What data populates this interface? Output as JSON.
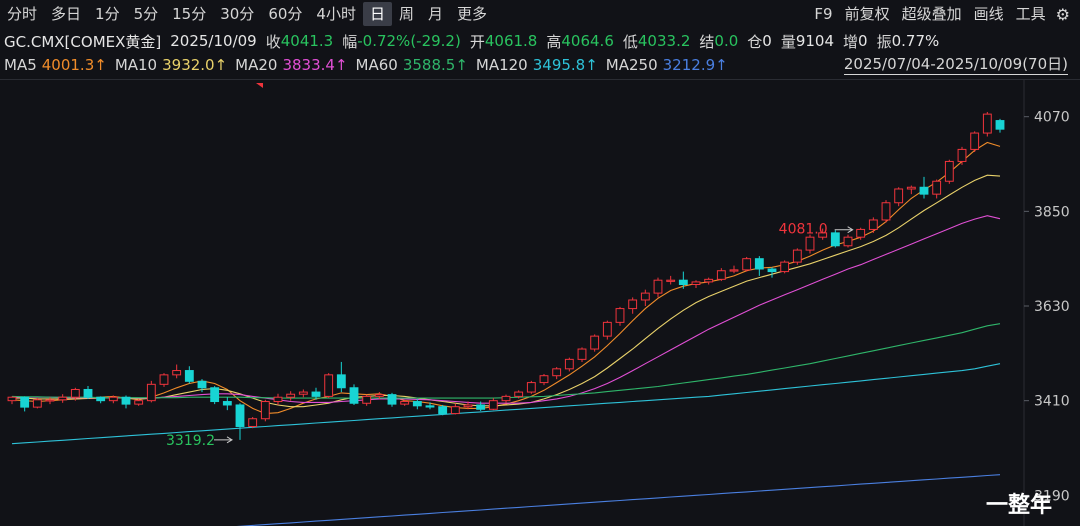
{
  "toolbar": {
    "periods": [
      "分时",
      "多日",
      "1分",
      "5分",
      "15分",
      "30分",
      "60分",
      "4小时",
      "日",
      "周",
      "月",
      "更多"
    ],
    "active_period": "日",
    "tools": [
      "F9",
      "前复权",
      "超级叠加",
      "画线",
      "工具"
    ],
    "gear_icon": "gear-icon"
  },
  "info": {
    "symbol": "GC.CMX[COMEX黄金]",
    "date": "2025/10/09",
    "close_label": "收",
    "close": "4041.3",
    "change_label": "幅",
    "change": "-0.72%(-29.2)",
    "open_label": "开",
    "open": "4061.8",
    "high_label": "高",
    "high": "4064.6",
    "low_label": "低",
    "low": "4033.2",
    "settle_label": "结",
    "settle": "0.0",
    "oi_label": "仓",
    "oi": "0",
    "volume_label": "量",
    "volume": "9104",
    "oi_change_label": "增",
    "oi_change": "0",
    "amplitude_label": "振",
    "amplitude": "0.77%"
  },
  "ma_row": [
    {
      "label": "MA5",
      "value": "4001.3↑",
      "color": "#f08c2a"
    },
    {
      "label": "MA10",
      "value": "3932.0↑",
      "color": "#e8d16a"
    },
    {
      "label": "MA20",
      "value": "3833.4↑",
      "color": "#e04fd4"
    },
    {
      "label": "MA60",
      "value": "3588.5↑",
      "color": "#2fb56a"
    },
    {
      "label": "MA120",
      "value": "3495.8↑",
      "color": "#2ec2d8"
    },
    {
      "label": "MA250",
      "value": "3212.9↑",
      "color": "#4a7fe0"
    }
  ],
  "date_range": "2025/07/04-2025/10/09(70日)",
  "watermark": "一整年",
  "chart_data": {
    "type": "candlestick",
    "y_ticks": [
      3190,
      3410,
      3630,
      3850,
      4070
    ],
    "ylim": [
      3128,
      4146
    ],
    "grid": false,
    "up_color": "#f0343c",
    "down_color": "#18d4d4",
    "annotations": [
      {
        "text": "4081.0",
        "color": "#f0343c",
        "at_index": 67
      },
      {
        "text": "3319.2",
        "color": "#29c35f",
        "at_index": 18
      }
    ],
    "candles": [
      [
        3410,
        3418,
        3402,
        3420
      ],
      [
        3418,
        3395,
        3385,
        3420
      ],
      [
        3395,
        3412,
        3392,
        3416
      ],
      [
        3412,
        3412,
        3402,
        3418
      ],
      [
        3412,
        3418,
        3405,
        3425
      ],
      [
        3418,
        3436,
        3410,
        3440
      ],
      [
        3436,
        3418,
        3414,
        3444
      ],
      [
        3418,
        3410,
        3404,
        3420
      ],
      [
        3410,
        3418,
        3404,
        3422
      ],
      [
        3418,
        3402,
        3392,
        3422
      ],
      [
        3402,
        3410,
        3398,
        3414
      ],
      [
        3410,
        3448,
        3406,
        3456
      ],
      [
        3448,
        3470,
        3442,
        3474
      ],
      [
        3470,
        3480,
        3462,
        3494
      ],
      [
        3480,
        3455,
        3450,
        3490
      ],
      [
        3455,
        3440,
        3430,
        3460
      ],
      [
        3440,
        3408,
        3402,
        3444
      ],
      [
        3408,
        3400,
        3388,
        3418
      ],
      [
        3400,
        3350,
        3319,
        3404
      ],
      [
        3350,
        3368,
        3346,
        3372
      ],
      [
        3368,
        3408,
        3362,
        3412
      ],
      [
        3408,
        3418,
        3400,
        3426
      ],
      [
        3418,
        3425,
        3410,
        3432
      ],
      [
        3425,
        3430,
        3418,
        3436
      ],
      [
        3430,
        3420,
        3412,
        3440
      ],
      [
        3420,
        3470,
        3416,
        3474
      ],
      [
        3470,
        3440,
        3430,
        3500
      ],
      [
        3440,
        3404,
        3400,
        3448
      ],
      [
        3404,
        3420,
        3398,
        3424
      ],
      [
        3420,
        3424,
        3414,
        3430
      ],
      [
        3424,
        3402,
        3396,
        3428
      ],
      [
        3402,
        3408,
        3398,
        3412
      ],
      [
        3408,
        3398,
        3390,
        3414
      ],
      [
        3398,
        3396,
        3390,
        3406
      ],
      [
        3396,
        3380,
        3376,
        3400
      ],
      [
        3380,
        3396,
        3378,
        3404
      ],
      [
        3396,
        3400,
        3390,
        3408
      ],
      [
        3400,
        3390,
        3386,
        3408
      ],
      [
        3390,
        3410,
        3388,
        3416
      ],
      [
        3410,
        3420,
        3405,
        3424
      ],
      [
        3420,
        3430,
        3415,
        3434
      ],
      [
        3430,
        3452,
        3426,
        3456
      ],
      [
        3452,
        3468,
        3446,
        3472
      ],
      [
        3468,
        3484,
        3460,
        3488
      ],
      [
        3484,
        3506,
        3478,
        3510
      ],
      [
        3506,
        3530,
        3500,
        3534
      ],
      [
        3530,
        3560,
        3524,
        3564
      ],
      [
        3560,
        3592,
        3552,
        3596
      ],
      [
        3592,
        3624,
        3584,
        3628
      ],
      [
        3624,
        3644,
        3612,
        3650
      ],
      [
        3644,
        3660,
        3630,
        3668
      ],
      [
        3660,
        3690,
        3650,
        3696
      ],
      [
        3690,
        3690,
        3680,
        3700
      ],
      [
        3690,
        3680,
        3670,
        3710
      ],
      [
        3680,
        3686,
        3672,
        3690
      ],
      [
        3686,
        3692,
        3680,
        3696
      ],
      [
        3692,
        3712,
        3688,
        3718
      ],
      [
        3712,
        3714,
        3706,
        3724
      ],
      [
        3714,
        3740,
        3710,
        3744
      ],
      [
        3740,
        3716,
        3700,
        3746
      ],
      [
        3716,
        3710,
        3696,
        3720
      ],
      [
        3710,
        3732,
        3706,
        3736
      ],
      [
        3732,
        3760,
        3726,
        3764
      ],
      [
        3760,
        3790,
        3752,
        3796
      ],
      [
        3790,
        3800,
        3784,
        3810
      ],
      [
        3800,
        3770,
        3766,
        3806
      ],
      [
        3770,
        3790,
        3766,
        3796
      ],
      [
        3790,
        3808,
        3784,
        3812
      ],
      [
        3808,
        3830,
        3800,
        3836
      ],
      [
        3830,
        3870,
        3824,
        3876
      ],
      [
        3870,
        3902,
        3862,
        3906
      ],
      [
        3902,
        3906,
        3890,
        3910
      ],
      [
        3906,
        3890,
        3880,
        3930
      ],
      [
        3890,
        3920,
        3880,
        3924
      ],
      [
        3920,
        3966,
        3914,
        3970
      ],
      [
        3966,
        3994,
        3958,
        4000
      ],
      [
        3994,
        4032,
        3988,
        4036
      ],
      [
        4032,
        4076,
        4024,
        4081
      ],
      [
        4061,
        4041,
        4033,
        4065
      ]
    ],
    "ma_lines": {
      "MA5": [
        3412,
        3410,
        3408,
        3410,
        3412,
        3414,
        3416,
        3418,
        3420,
        3416,
        3412,
        3418,
        3428,
        3440,
        3450,
        3456,
        3450,
        3436,
        3410,
        3392,
        3380,
        3382,
        3392,
        3404,
        3414,
        3420,
        3428,
        3426,
        3424,
        3426,
        3420,
        3410,
        3408,
        3404,
        3398,
        3394,
        3392,
        3392,
        3396,
        3402,
        3410,
        3420,
        3434,
        3452,
        3470,
        3490,
        3512,
        3538,
        3566,
        3596,
        3624,
        3648,
        3666,
        3676,
        3682,
        3686,
        3692,
        3700,
        3712,
        3718,
        3720,
        3726,
        3734,
        3746,
        3760,
        3772,
        3780,
        3790,
        3804,
        3826,
        3854,
        3880,
        3900,
        3918,
        3940,
        3966,
        3992,
        4010,
        4001
      ],
      "MA10": [
        3416,
        3416,
        3414,
        3414,
        3414,
        3414,
        3415,
        3416,
        3417,
        3416,
        3414,
        3415,
        3418,
        3424,
        3430,
        3436,
        3438,
        3434,
        3426,
        3416,
        3406,
        3400,
        3396,
        3396,
        3400,
        3404,
        3412,
        3418,
        3420,
        3422,
        3422,
        3420,
        3416,
        3412,
        3408,
        3404,
        3400,
        3398,
        3398,
        3400,
        3402,
        3406,
        3414,
        3424,
        3436,
        3450,
        3466,
        3486,
        3508,
        3530,
        3554,
        3578,
        3600,
        3620,
        3638,
        3652,
        3664,
        3676,
        3688,
        3696,
        3704,
        3712,
        3720,
        3728,
        3738,
        3748,
        3758,
        3768,
        3780,
        3794,
        3812,
        3832,
        3852,
        3870,
        3888,
        3906,
        3922,
        3934,
        3932
      ],
      "MA20": [
        3418,
        3418,
        3418,
        3418,
        3417,
        3417,
        3417,
        3417,
        3417,
        3417,
        3416,
        3416,
        3418,
        3420,
        3422,
        3424,
        3426,
        3426,
        3424,
        3420,
        3416,
        3412,
        3408,
        3406,
        3406,
        3406,
        3408,
        3410,
        3412,
        3414,
        3414,
        3414,
        3413,
        3412,
        3410,
        3408,
        3406,
        3404,
        3404,
        3404,
        3404,
        3406,
        3410,
        3414,
        3420,
        3428,
        3438,
        3450,
        3464,
        3480,
        3496,
        3512,
        3528,
        3544,
        3560,
        3576,
        3590,
        3604,
        3618,
        3632,
        3644,
        3656,
        3668,
        3680,
        3692,
        3704,
        3716,
        3726,
        3738,
        3750,
        3762,
        3774,
        3786,
        3798,
        3810,
        3822,
        3832,
        3840,
        3833
      ],
      "MA60": [
        3420,
        3419,
        3419,
        3418,
        3418,
        3418,
        3418,
        3417,
        3417,
        3417,
        3417,
        3417,
        3417,
        3417,
        3418,
        3418,
        3418,
        3418,
        3418,
        3417,
        3417,
        3416,
        3416,
        3416,
        3416,
        3416,
        3416,
        3416,
        3416,
        3416,
        3416,
        3416,
        3416,
        3416,
        3416,
        3416,
        3416,
        3416,
        3416,
        3417,
        3418,
        3419,
        3420,
        3422,
        3424,
        3426,
        3428,
        3431,
        3434,
        3437,
        3440,
        3443,
        3447,
        3451,
        3455,
        3459,
        3463,
        3467,
        3471,
        3476,
        3481,
        3486,
        3491,
        3496,
        3502,
        3508,
        3514,
        3520,
        3526,
        3532,
        3538,
        3544,
        3550,
        3556,
        3562,
        3568,
        3576,
        3584,
        3589
      ],
      "MA120": [
        3310,
        3312,
        3314,
        3316,
        3318,
        3320,
        3322,
        3324,
        3326,
        3328,
        3330,
        3332,
        3334,
        3336,
        3338,
        3340,
        3342,
        3344,
        3346,
        3348,
        3350,
        3352,
        3354,
        3356,
        3358,
        3360,
        3362,
        3364,
        3366,
        3368,
        3370,
        3372,
        3374,
        3376,
        3378,
        3380,
        3382,
        3384,
        3386,
        3388,
        3390,
        3392,
        3394,
        3396,
        3398,
        3400,
        3402,
        3404,
        3406,
        3408,
        3410,
        3412,
        3414,
        3416,
        3418,
        3420,
        3423,
        3426,
        3429,
        3432,
        3435,
        3438,
        3441,
        3444,
        3447,
        3450,
        3453,
        3456,
        3459,
        3462,
        3465,
        3468,
        3471,
        3474,
        3477,
        3480,
        3484,
        3490,
        3496
      ],
      "MA250": [
        3082,
        3084,
        3086,
        3088,
        3090,
        3092,
        3094,
        3096,
        3098,
        3100,
        3102,
        3104,
        3106,
        3108,
        3110,
        3112,
        3114,
        3116,
        3118,
        3120,
        3122,
        3124,
        3126,
        3128,
        3130,
        3132,
        3134,
        3136,
        3138,
        3140,
        3142,
        3144,
        3146,
        3148,
        3150,
        3152,
        3154,
        3156,
        3158,
        3160,
        3162,
        3164,
        3166,
        3168,
        3170,
        3172,
        3174,
        3176,
        3178,
        3180,
        3182,
        3184,
        3186,
        3188,
        3190,
        3192,
        3194,
        3196,
        3198,
        3200,
        3202,
        3204,
        3206,
        3208,
        3210,
        3212,
        3214,
        3216,
        3218,
        3220,
        3222,
        3224,
        3226,
        3228,
        3230,
        3232,
        3234,
        3236,
        3238
      ]
    }
  }
}
